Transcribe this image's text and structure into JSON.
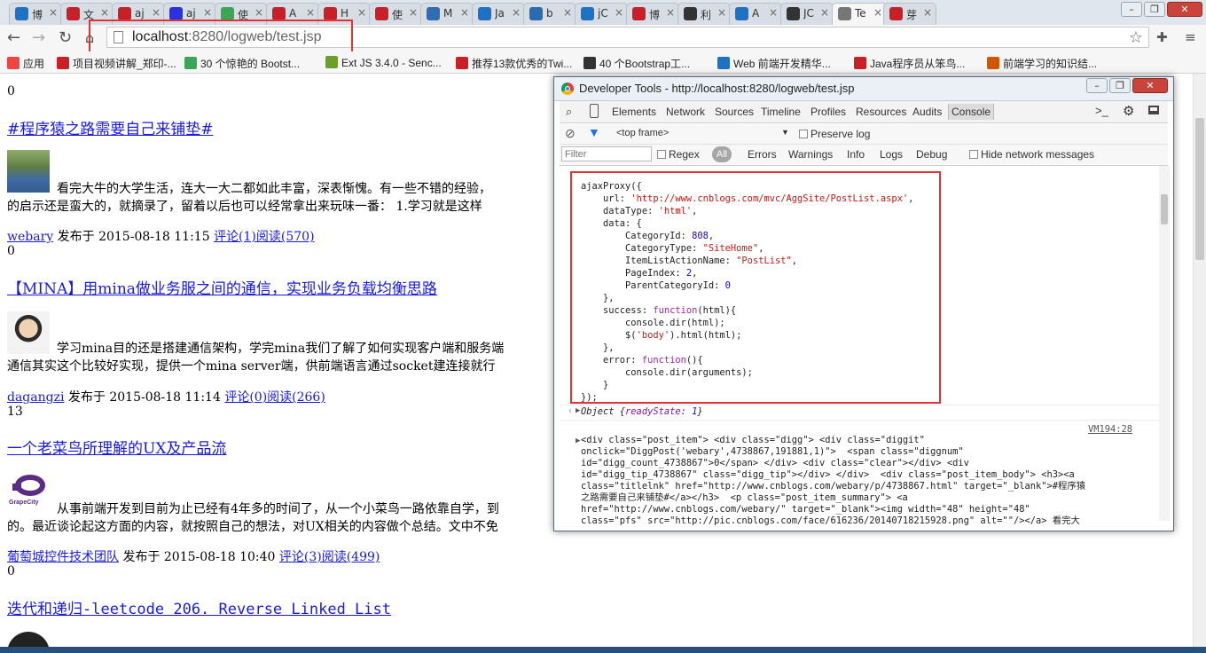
{
  "browser": {
    "tabs": [
      {
        "label": "博",
        "icon": "ie-blue-icon",
        "color": "#1d72c4"
      },
      {
        "label": "文",
        "icon": "csdn-red-icon",
        "color": "#c92027"
      },
      {
        "label": "aj",
        "icon": "csdn-red-icon",
        "color": "#c92027"
      },
      {
        "label": "aj",
        "icon": "baidu-paw-icon",
        "color": "#2932e1"
      },
      {
        "label": "使",
        "icon": "green-c-icon",
        "color": "#3aa757"
      },
      {
        "label": "A",
        "icon": "csdn-red-icon",
        "color": "#c92027"
      },
      {
        "label": "H",
        "icon": "csdn-red-icon",
        "color": "#c92027"
      },
      {
        "label": "使",
        "icon": "csdn-red-icon",
        "color": "#c92027"
      },
      {
        "label": "M",
        "icon": "mdn-icon",
        "color": "#2e6db4"
      },
      {
        "label": "Ja",
        "icon": "ie-blue-icon",
        "color": "#1d72c4"
      },
      {
        "label": "b",
        "icon": "moon-icon",
        "color": "#2b6cb0"
      },
      {
        "label": "jC",
        "icon": "ie-blue-icon",
        "color": "#1d72c4"
      },
      {
        "label": "博",
        "icon": "csdn-red-icon",
        "color": "#c92027"
      },
      {
        "label": "利",
        "icon": "github-icon",
        "color": "#333333"
      },
      {
        "label": "A",
        "icon": "ie-blue-icon",
        "color": "#1d72c4"
      },
      {
        "label": "JC",
        "icon": "github-icon",
        "color": "#333333"
      },
      {
        "label": "Te",
        "icon": "page-icon",
        "color": "#777777"
      },
      {
        "label": "芽",
        "icon": "jd-icon",
        "color": "#c92027"
      }
    ],
    "url_host": "localhost",
    "url_path": ":8280/logweb/test.jsp"
  },
  "bookmarks": [
    {
      "label": "应用",
      "icon": "apps-grid-icon",
      "color": "#e44"
    },
    {
      "label": "项目视频讲解_郑印-...",
      "icon": "csdn-red-icon",
      "color": "#c92027"
    },
    {
      "label": "30 个惊艳的 Bootst...",
      "icon": "green-c-icon",
      "color": "#3aa757"
    },
    {
      "label": "Ext JS 3.4.0 - Senc...",
      "icon": "leaf-icon",
      "color": "#6a9f2a"
    },
    {
      "label": "推荐13款优秀的Twi...",
      "icon": "csdn-red-icon",
      "color": "#c92027"
    },
    {
      "label": "40 个Bootstrap工...",
      "icon": "github-icon",
      "color": "#333333"
    },
    {
      "label": "Web 前端开发精华...",
      "icon": "ie-blue-icon",
      "color": "#1d72c4"
    },
    {
      "label": "Java程序员从笨鸟...",
      "icon": "csdn-red-icon",
      "color": "#c92027"
    },
    {
      "label": "前端学习的知识结...",
      "icon": "fire-icon",
      "color": "#d35400"
    }
  ],
  "page": {
    "posts": [
      {
        "count": "0",
        "title": "#程序猿之路需要自己来铺垫#",
        "line1": "看完大牛的大学生活，连大一大二都如此丰富，深表惭愧。有一些不错的经验，",
        "line2": "的启示还是蛮大的，就摘录了，留着以后也可以经常拿出来玩味一番： 1.学习就是这样",
        "author": "webary",
        "meta": "发布于 2015-08-18 11:15",
        "stats": "评论(1)阅读(570)"
      },
      {
        "count": "0",
        "title": "【MINA】用mina做业务服之间的通信，实现业务负载均衡思路",
        "line1": "学习mina目的还是搭建通信架构，学完mina我们了解了如何实现客户端和服务端",
        "line2": "通信其实这个比较好实现，提供一个mina server端，供前端语言通过socket建连接就行",
        "author": "dagangzi",
        "meta": "发布于 2015-08-18 11:14",
        "stats": "评论(0)阅读(266)"
      },
      {
        "count": "13",
        "title": "一个老菜鸟所理解的UX及产品流",
        "line1": "从事前端开发到目前为止已经有4年多的时间了，从一个小菜鸟一路依靠自学，到",
        "line2": "的。最近谈论起这方面的内容，就按照自己的想法，对UX相关的内容做个总结。文中不免",
        "author": "葡萄城控件技术团队",
        "meta": "发布于 2015-08-18 10:40",
        "stats": "评论(3)阅读(499)"
      },
      {
        "count": "0",
        "title": "迭代和递归-leetcode 206. Reverse Linked List"
      }
    ],
    "grapecity_logo_text": "GrapeCity"
  },
  "devtools": {
    "title": "Developer Tools - http://localhost:8280/logweb/test.jsp",
    "tabs": [
      "Elements",
      "Network",
      "Sources",
      "Timeline",
      "Profiles",
      "Resources",
      "Audits",
      "Console"
    ],
    "frame_selector": "<top frame>",
    "preserve_log": "Preserve log",
    "filter_placeholder": "Filter",
    "regex": "Regex",
    "levels": [
      "All",
      "Errors",
      "Warnings",
      "Info",
      "Logs",
      "Debug"
    ],
    "hide_network": "Hide network messages",
    "object_result_prefix": "Object {",
    "object_key": "readyState",
    "object_value": "1",
    "object_result_suffix": "}",
    "vm_link": "VM194:28",
    "html_output": "<div class=\"post_item\"> <div class=\"digg\"> <div class=\"diggit\"\nonclick=\"DiggPost('webary',4738867,191881,1)\">  <span class=\"diggnum\"\nid=\"digg_count_4738867\">0</span> </div> <div class=\"clear\"></div> <div\nid=\"digg_tip_4738867\" class=\"digg_tip\"></div> </div>  <div class=\"post_item_body\"> <h3><a\nclass=\"titlelnk\" href=\"http://www.cnblogs.com/webary/p/4738867.html\" target=\"_blank\">#程序猿\n之路需要自己来铺垫#</a></h3>  <p class=\"post_item_summary\"> <a\nhref=\"http://www.cnblogs.com/webary/\" target=\"_blank\"><img width=\"48\" height=\"48\"\nclass=\"pfs\" src=\"http://pic.cnblogs.com/face/616236/20140718215928.png\" alt=\"\"/></a> 看完大"
  }
}
